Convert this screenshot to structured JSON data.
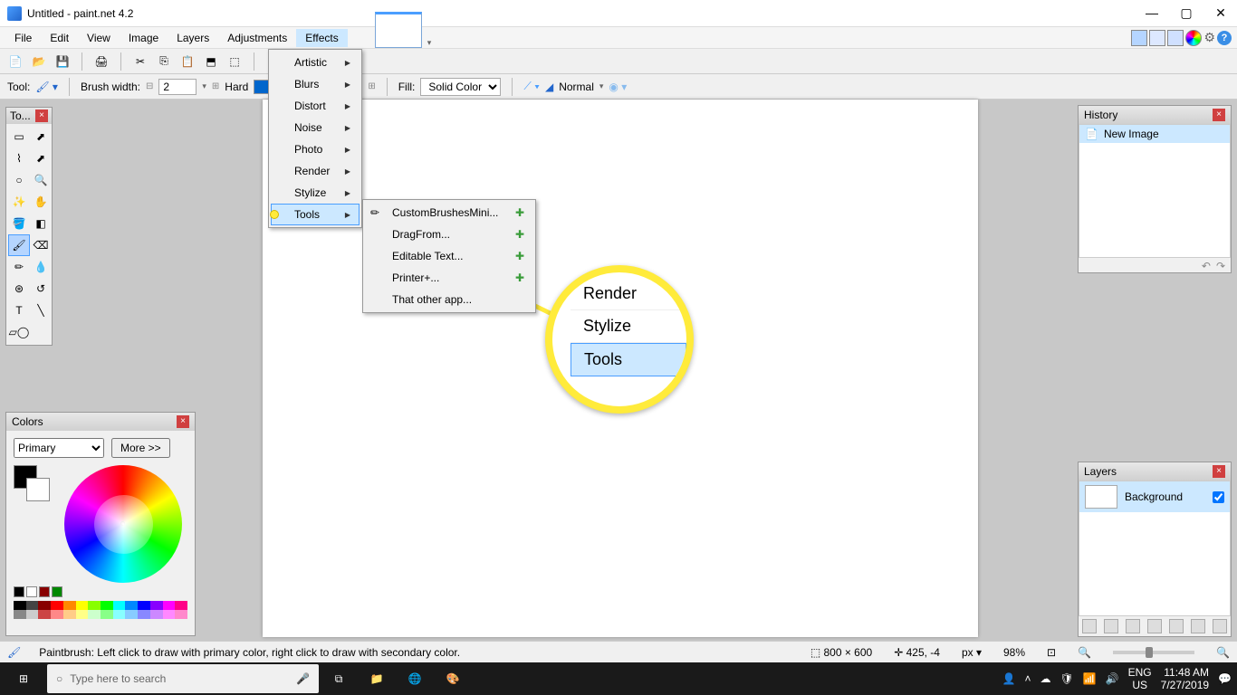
{
  "titlebar": {
    "title": "Untitled - paint.net 4.2"
  },
  "menubar": {
    "items": [
      "File",
      "Edit",
      "View",
      "Image",
      "Layers",
      "Adjustments",
      "Effects"
    ],
    "active": "Effects"
  },
  "options": {
    "tool_label": "Tool:",
    "brush_width_label": "Brush width:",
    "brush_width_value": "2",
    "hardness_label": "Hard",
    "fill_label": "Fill:",
    "fill_value": "Solid Color",
    "blend_value": "Normal"
  },
  "effects_menu": {
    "items": [
      "Artistic",
      "Blurs",
      "Distort",
      "Noise",
      "Photo",
      "Render",
      "Stylize",
      "Tools"
    ],
    "highlighted": "Tools"
  },
  "tools_submenu": {
    "items": [
      "CustomBrushesMini...",
      "DragFrom...",
      "Editable Text...",
      "Printer+...",
      "That other app..."
    ]
  },
  "magnifier": {
    "items": [
      "Render",
      "Stylize",
      "Tools"
    ],
    "highlighted": "Tools"
  },
  "tools_panel": {
    "title": "To..."
  },
  "colors_panel": {
    "title": "Colors",
    "selector": "Primary",
    "more_btn": "More  >>"
  },
  "history_panel": {
    "title": "History",
    "items": [
      "New Image"
    ]
  },
  "layers_panel": {
    "title": "Layers",
    "items": [
      {
        "name": "Background",
        "checked": true
      }
    ]
  },
  "statusbar": {
    "hint": "Paintbrush: Left click to draw with primary color, right click to draw with secondary color.",
    "dims": "800 × 600",
    "cursor": "425, -4",
    "unit": "px",
    "zoom": "98%"
  },
  "taskbar": {
    "search_placeholder": "Type here to search",
    "lang": "ENG",
    "locale": "US",
    "time": "11:48 AM",
    "date": "7/27/2019"
  }
}
